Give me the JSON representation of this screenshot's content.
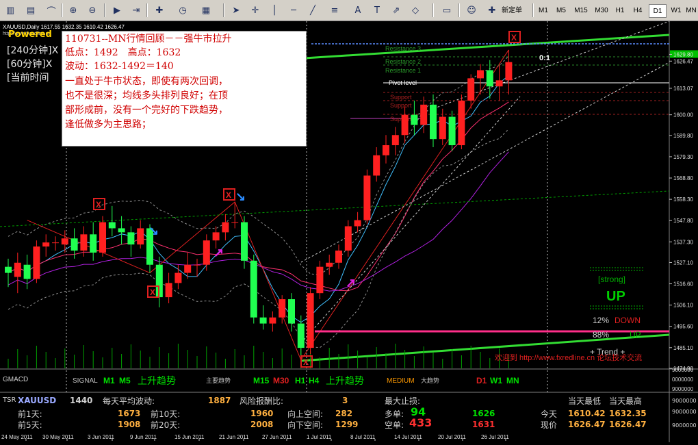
{
  "symbol_header": "XAUUSD,Daily  1617.55 1632.35 1610.42 1626.47",
  "header_small": "http://www.fxredline.cn",
  "note": {
    "title": "110731--MN行情回顾－－强牛市拉升",
    "powered": "Powered",
    "lines": [
      "低点：1492　高点：1632",
      "波动：1632-1492＝140",
      "一直处于牛市状态，即使有两次回调，",
      "也不是很深；均线多头排列良好；在顶",
      "部形成前，没有一个完好的下跌趋势，",
      "逢低做多为主思路；"
    ],
    "side_labels": [
      "[240分钟]X",
      "[60分钟]X",
      "[当前时间"
    ]
  },
  "levels": {
    "resistance3": "Resistance 3",
    "resistance2": "Resistance 2",
    "resistance1": "Resistance 1",
    "pivot": "Pivot level",
    "support1": "Support",
    "support2": "Support",
    "support3": "Support",
    "ratio": "0:1"
  },
  "price_axis": [
    {
      "label": "1629.80",
      "bg": "#00c000"
    },
    {
      "label": "1626.47",
      "bg": null
    },
    {
      "label": "1613.07",
      "bg": null
    },
    {
      "label": "1600.00",
      "bg": null
    },
    {
      "label": "1589.80",
      "bg": null
    },
    {
      "label": "1579.30",
      "bg": null
    },
    {
      "label": "1568.80",
      "bg": null
    },
    {
      "label": "1558.30",
      "bg": null
    },
    {
      "label": "1547.80",
      "bg": null
    },
    {
      "label": "1537.30",
      "bg": null
    },
    {
      "label": "1527.10",
      "bg": null
    },
    {
      "label": "1516.60",
      "bg": null
    },
    {
      "label": "1506.10",
      "bg": null
    },
    {
      "label": "1495.60",
      "bg": null
    },
    {
      "label": "1485.10",
      "bg": null
    },
    {
      "label": "1474.90",
      "bg": null
    }
  ],
  "signal_panel": {
    "name": "GMACD",
    "signal_label": "SIGNAL",
    "m1": "M1",
    "m5": "M5",
    "trend1": "上升趋势",
    "main_trend": "主要趋势",
    "m15": "M15",
    "m30": "M30",
    "h1": "H1",
    "h4": "H4",
    "trend2": "上升趋势",
    "medium": "MEDIUM",
    "big_trend": "大趋势",
    "d1": "D1",
    "w1": "W1",
    "mn": "MN",
    "axis": [
      "9000000",
      "0000000",
      "9000000"
    ]
  },
  "strength": {
    "strong": "[strong]",
    "up": "UP",
    "pct_down": "12%",
    "down": "DOWN",
    "pct_up": "88%",
    "up2": "UP",
    "trend": "+  Trend  +"
  },
  "watermark": "欢迎到 http://www.fxredline.cn 论坛技术交流",
  "tsr": {
    "name": "TSR",
    "symbol": "XAUUSD",
    "period": "1440",
    "avg_label": "每天平均波动:",
    "avg_value": "1887",
    "rr_label": "风险报酬比:",
    "rr_value": "3",
    "max_stop_label": "最大止损:",
    "day_low_label": "当天最低",
    "day_high_label": "当天最高",
    "d1_label": "前1天:",
    "d1_value": "1673",
    "d10_label": "前10天:",
    "d10_value": "1960",
    "up_space_label": "向上空间:",
    "up_space_value": "282",
    "long_label": "多单:",
    "long_value": "94",
    "long_price": "1626",
    "today_label": "今天",
    "today_low": "1610.42",
    "today_high": "1632.35",
    "d5_label": "前5天:",
    "d5_value": "1908",
    "d20_label": "前20天:",
    "d20_value": "2008",
    "down_space_label": "向下空间:",
    "down_space_value": "1299",
    "short_label": "空单:",
    "short_value": "433",
    "short_price": "1631",
    "now_label": "现价",
    "now_low": "1626.47",
    "now_high": "1626.47",
    "axis": [
      "9000000",
      "9000000",
      "9000000"
    ]
  },
  "dates": [
    "24 May 2011",
    "30 May 2011",
    "3 Jun 2011",
    "9 Jun 2011",
    "15 Jun 2011",
    "21 Jun 2011",
    "27 Jun 2011",
    "1 Jul 2011",
    "8 Jul 2011",
    "14 Jul 2011",
    "20 Jul 2011",
    "26 Jul 2011"
  ],
  "timeframes": [
    "M1",
    "M5",
    "M15",
    "M30",
    "H1",
    "H4",
    "D1",
    "W1",
    "MN"
  ],
  "active_timeframe": "D1",
  "new_order": "新定单",
  "chart_data": {
    "type": "candlestick",
    "symbol": "XAUUSD",
    "ylim": [
      1474.9,
      1634
    ],
    "candles": [
      {
        "o": 1525,
        "c": 1522,
        "h": 1529,
        "l": 1515
      },
      {
        "o": 1520,
        "c": 1527,
        "h": 1532,
        "l": 1512
      },
      {
        "o": 1526,
        "c": 1519,
        "h": 1531,
        "l": 1514
      },
      {
        "o": 1519,
        "c": 1535,
        "h": 1538,
        "l": 1517
      },
      {
        "o": 1535,
        "c": 1537,
        "h": 1541,
        "l": 1530
      },
      {
        "o": 1537,
        "c": 1537,
        "h": 1540,
        "l": 1533
      },
      {
        "o": 1536,
        "c": 1539,
        "h": 1543,
        "l": 1532
      },
      {
        "o": 1539,
        "c": 1533,
        "h": 1544,
        "l": 1529
      },
      {
        "o": 1533,
        "c": 1541,
        "h": 1545,
        "l": 1530
      },
      {
        "o": 1541,
        "c": 1532,
        "h": 1547,
        "l": 1528
      },
      {
        "o": 1532,
        "c": 1547,
        "h": 1550,
        "l": 1530
      },
      {
        "o": 1547,
        "c": 1544,
        "h": 1555,
        "l": 1540
      },
      {
        "o": 1544,
        "c": 1542,
        "h": 1550,
        "l": 1536
      },
      {
        "o": 1542,
        "c": 1536,
        "h": 1545,
        "l": 1530
      },
      {
        "o": 1536,
        "c": 1544,
        "h": 1548,
        "l": 1534
      },
      {
        "o": 1544,
        "c": 1526,
        "h": 1546,
        "l": 1522
      },
      {
        "o": 1526,
        "c": 1510,
        "h": 1530,
        "l": 1505
      },
      {
        "o": 1510,
        "c": 1517,
        "h": 1522,
        "l": 1507
      },
      {
        "o": 1517,
        "c": 1522,
        "h": 1526,
        "l": 1514
      },
      {
        "o": 1522,
        "c": 1526,
        "h": 1532,
        "l": 1519
      },
      {
        "o": 1526,
        "c": 1526,
        "h": 1529,
        "l": 1520
      },
      {
        "o": 1526,
        "c": 1538,
        "h": 1541,
        "l": 1523
      },
      {
        "o": 1538,
        "c": 1542,
        "h": 1545,
        "l": 1534
      },
      {
        "o": 1542,
        "c": 1547,
        "h": 1551,
        "l": 1538
      },
      {
        "o": 1547,
        "c": 1547,
        "h": 1557,
        "l": 1544
      },
      {
        "o": 1547,
        "c": 1528,
        "h": 1550,
        "l": 1524
      },
      {
        "o": 1528,
        "c": 1500,
        "h": 1531,
        "l": 1497
      },
      {
        "o": 1500,
        "c": 1497,
        "h": 1506,
        "l": 1494
      },
      {
        "o": 1497,
        "c": 1500,
        "h": 1503,
        "l": 1493
      },
      {
        "o": 1500,
        "c": 1509,
        "h": 1511,
        "l": 1497
      },
      {
        "o": 1509,
        "c": 1497,
        "h": 1512,
        "l": 1493
      },
      {
        "o": 1497,
        "c": 1485,
        "h": 1501,
        "l": 1479
      },
      {
        "o": 1485,
        "c": 1512,
        "h": 1515,
        "l": 1482
      },
      {
        "o": 1512,
        "c": 1525,
        "h": 1528,
        "l": 1509
      },
      {
        "o": 1525,
        "c": 1527,
        "h": 1531,
        "l": 1521
      },
      {
        "o": 1527,
        "c": 1533,
        "h": 1536,
        "l": 1524
      },
      {
        "o": 1533,
        "c": 1545,
        "h": 1548,
        "l": 1530
      },
      {
        "o": 1545,
        "c": 1548,
        "h": 1552,
        "l": 1542
      },
      {
        "o": 1548,
        "c": 1570,
        "h": 1573,
        "l": 1546
      },
      {
        "o": 1570,
        "c": 1580,
        "h": 1584,
        "l": 1567
      },
      {
        "o": 1580,
        "c": 1585,
        "h": 1590,
        "l": 1576
      },
      {
        "o": 1585,
        "c": 1590,
        "h": 1594,
        "l": 1580
      },
      {
        "o": 1590,
        "c": 1600,
        "h": 1604,
        "l": 1586
      },
      {
        "o": 1600,
        "c": 1595,
        "h": 1607,
        "l": 1590
      },
      {
        "o": 1595,
        "c": 1605,
        "h": 1609,
        "l": 1591
      },
      {
        "o": 1605,
        "c": 1588,
        "h": 1610,
        "l": 1584
      },
      {
        "o": 1588,
        "c": 1599,
        "h": 1603,
        "l": 1585
      },
      {
        "o": 1599,
        "c": 1585,
        "h": 1602,
        "l": 1582
      },
      {
        "o": 1585,
        "c": 1607,
        "h": 1610,
        "l": 1583
      },
      {
        "o": 1607,
        "c": 1618,
        "h": 1620,
        "l": 1603
      },
      {
        "o": 1618,
        "c": 1622,
        "h": 1625,
        "l": 1610
      },
      {
        "o": 1622,
        "c": 1614,
        "h": 1627,
        "l": 1608
      },
      {
        "o": 1614,
        "c": 1617,
        "h": 1625,
        "l": 1607
      },
      {
        "o": 1617,
        "c": 1626,
        "h": 1632,
        "l": 1610
      }
    ]
  }
}
